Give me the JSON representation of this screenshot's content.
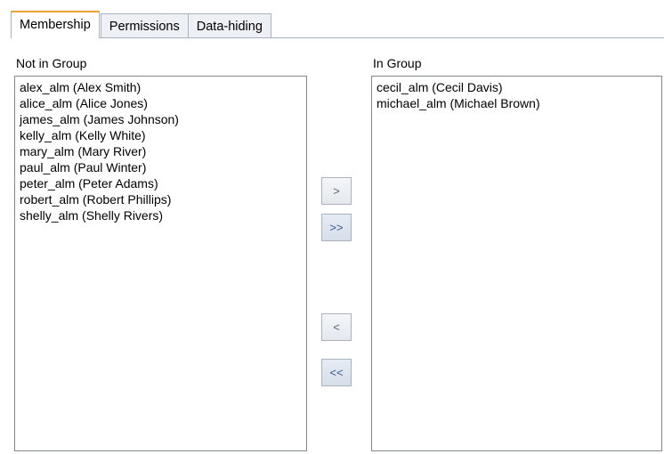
{
  "tabs": [
    {
      "label": "Membership",
      "active": true
    },
    {
      "label": "Permissions",
      "active": false
    },
    {
      "label": "Data-hiding",
      "active": false
    }
  ],
  "not_in_group": {
    "label": "Not in Group",
    "items": [
      "alex_alm (Alex Smith)",
      "alice_alm (Alice Jones)",
      "james_alm (James Johnson)",
      "kelly_alm (Kelly White)",
      "mary_alm (Mary River)",
      "paul_alm (Paul Winter)",
      "peter_alm (Peter Adams)",
      "robert_alm (Robert Phillips)",
      "shelly_alm (Shelly Rivers)"
    ]
  },
  "in_group": {
    "label": "In Group",
    "items": [
      "cecil_alm (Cecil Davis)",
      "michael_alm (Michael Brown)"
    ]
  },
  "buttons": {
    "add_one": ">",
    "add_all": ">>",
    "remove_one": "<",
    "remove_all": "<<"
  },
  "colors": {
    "active_tab_accent": "#f0a030",
    "border": "#a9b3c0"
  }
}
